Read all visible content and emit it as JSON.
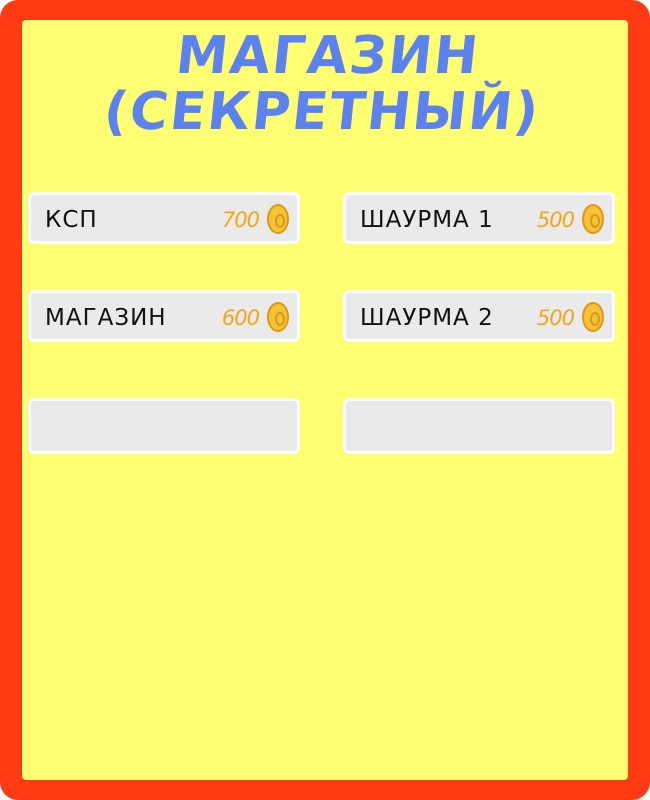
{
  "title": {
    "line1": "МАГАЗИН",
    "line2": "(СЕКРЕТНЫЙ)"
  },
  "colors": {
    "frame": "#ff3b14",
    "panel": "#fffd72",
    "title": "#5b82ef",
    "price": "#f3a51c",
    "slot": "#eaeaea"
  },
  "items": [
    {
      "name": "КСП",
      "price": "700",
      "icon": "coin-icon"
    },
    {
      "name": "ШАУРМА 1",
      "price": "500",
      "icon": "coin-icon"
    },
    {
      "name": "МАГАЗИН",
      "price": "600",
      "icon": "coin-icon"
    },
    {
      "name": "ШАУРМА 2",
      "price": "500",
      "icon": "coin-icon"
    }
  ],
  "empty_slots": 2
}
